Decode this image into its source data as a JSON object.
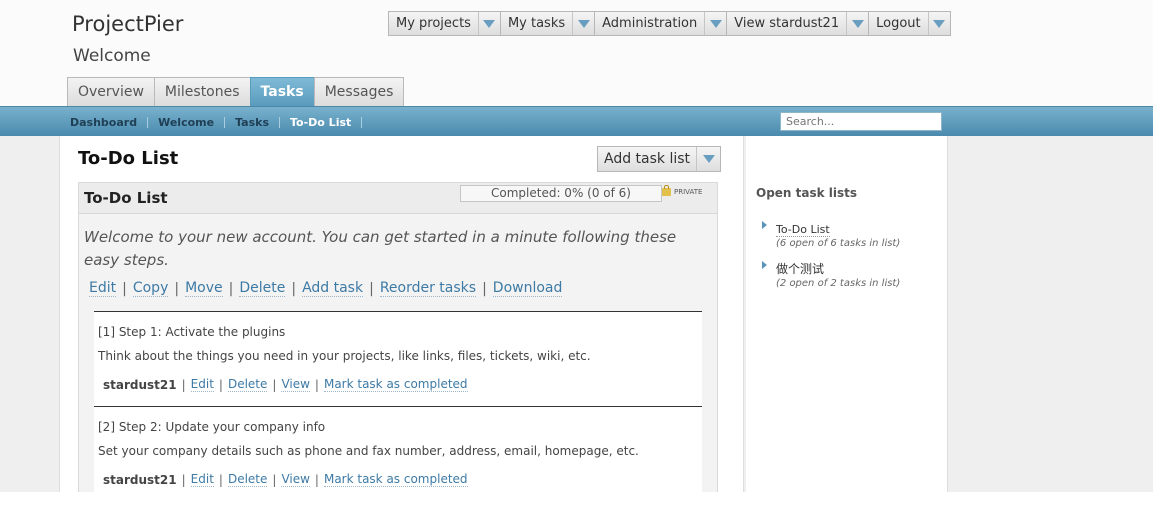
{
  "app": {
    "title": "ProjectPier",
    "subtitle": "Welcome"
  },
  "account_menu": [
    {
      "label": "My projects"
    },
    {
      "label": "My tasks"
    },
    {
      "label": "Administration"
    },
    {
      "label": "View stardust21"
    },
    {
      "label": "Logout"
    }
  ],
  "tabs": [
    {
      "label": "Overview"
    },
    {
      "label": "Milestones"
    },
    {
      "label": "Tasks",
      "active": true
    },
    {
      "label": "Messages"
    }
  ],
  "breadcrumbs": [
    "Dashboard",
    "Welcome",
    "Tasks",
    "To-Do List"
  ],
  "search": {
    "placeholder": "Search..."
  },
  "page": {
    "title": "To-Do List",
    "add_button": "Add task list"
  },
  "list": {
    "title": "To-Do List",
    "progress_text": "Completed: 0% (0 of 6)",
    "progress_fraction": 0,
    "private_label": "PRIVATE",
    "description": "Welcome to your new account. You can get started in a minute following these easy steps.",
    "actions": [
      "Edit",
      "Copy",
      "Move",
      "Delete",
      "Add task",
      "Reorder tasks",
      "Download"
    ]
  },
  "tasks": [
    {
      "title": "[1] Step 1: Activate the plugins",
      "text": "Think about the things you need in your projects, like links, files, tickets, wiki, etc.",
      "owner": "stardust21",
      "links": [
        "Edit",
        "Delete",
        "View",
        "Mark task as completed"
      ]
    },
    {
      "title": "[2] Step 2: Update your company info",
      "text": "Set your company details such as phone and fax number, address, email, homepage, etc.",
      "owner": "stardust21",
      "links": [
        "Edit",
        "Delete",
        "View",
        "Mark task as completed"
      ]
    }
  ],
  "sidebar": {
    "title": "Open task lists",
    "lists": [
      {
        "name": "To-Do List",
        "meta": "(6 open of 6 tasks in list)"
      },
      {
        "name": "做个测试",
        "meta": "(2 open of 2 tasks in list)"
      }
    ]
  },
  "colors": {
    "accent": "#5a9bbd",
    "link": "#3d7aa5",
    "header_bar": "#4a8aad"
  },
  "icons": {
    "dropdown": "dropdown-arrow-icon",
    "lock": "lock-icon",
    "bullet": "triangle-bullet-icon"
  }
}
